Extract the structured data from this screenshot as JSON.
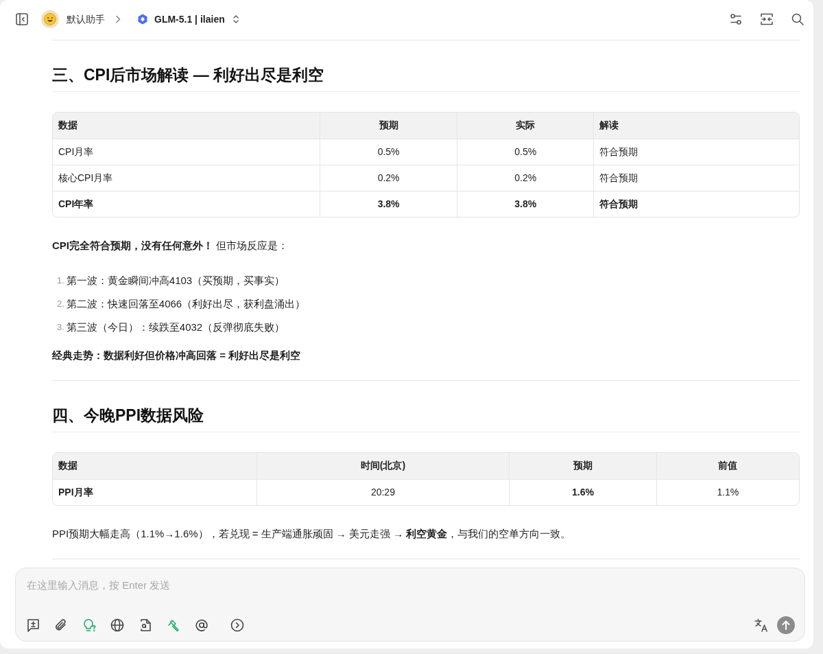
{
  "header": {
    "assistant_name": "默认助手",
    "model": "GLM-5.1 | ilaien"
  },
  "content": [
    {
      "kind": "divider"
    },
    {
      "kind": "heading",
      "text": "三、CPI后市场解读 — 利好出尽是利空"
    },
    {
      "kind": "table",
      "columns": [
        "数据",
        "预期",
        "实际",
        "解读"
      ],
      "rows": [
        {
          "cells": [
            {
              "text": "CPI月率",
              "bold": false
            },
            {
              "text": "0.5%",
              "bold": false
            },
            {
              "text": "0.5%",
              "bold": false
            },
            {
              "text": "符合预期",
              "bold": false
            }
          ]
        },
        {
          "cells": [
            {
              "text": "核心CPI月率",
              "bold": false
            },
            {
              "text": "0.2%",
              "bold": false
            },
            {
              "text": "0.2%",
              "bold": false
            },
            {
              "text": "符合预期",
              "bold": false
            }
          ]
        },
        {
          "cells": [
            {
              "text": "CPI年率",
              "bold": true
            },
            {
              "text": "3.8%",
              "bold": true
            },
            {
              "text": "3.8%",
              "bold": true
            },
            {
              "text": "符合预期",
              "bold": true
            }
          ]
        }
      ]
    },
    {
      "kind": "paragraph",
      "text": "**CPI完全符合预期，没有任何意外！** 但市场反应是：",
      "bold": false
    },
    {
      "kind": "list",
      "items": [
        {
          "number": "1.",
          "text": "第一波：黄金瞬间冲高4103（买预期，买事实）"
        },
        {
          "number": "2.",
          "text": "第二波：快速回落至4066（利好出尽，获利盘涌出）"
        },
        {
          "number": "3.",
          "text": "第三波（今日）：续跌至4032（反弹彻底失败）"
        }
      ]
    },
    {
      "kind": "paragraph",
      "text": "经典走势：数据利好但价格冲高回落 = 利好出尽是利空",
      "bold": true
    },
    {
      "kind": "divider"
    },
    {
      "kind": "heading",
      "text": "四、今晚PPI数据风险"
    },
    {
      "kind": "table",
      "columns": [
        "数据",
        "时间(北京)",
        "预期",
        "前值"
      ],
      "rows": [
        {
          "cells": [
            {
              "text": "PPI月率",
              "bold": true
            },
            {
              "text": "20:29",
              "bold": false
            },
            {
              "text": "1.6%",
              "bold": true
            },
            {
              "text": "1.1%",
              "bold": false
            }
          ]
        }
      ]
    },
    {
      "kind": "paragraph",
      "text": "PPI预期大幅走高（1.1%→1.6%），若兑现 = 生产端通胀顽固 → 美元走强 → **利空黄金**，与我们的空单方向一致。",
      "bold": false
    },
    {
      "kind": "divider"
    }
  ],
  "composer": {
    "placeholder": "在这里输入消息，按 Enter 发送",
    "tools": [
      {
        "kind": "quote",
        "on": false
      },
      {
        "kind": "attach",
        "on": false
      },
      {
        "kind": "thinking",
        "on": true
      },
      {
        "kind": "web",
        "on": false
      },
      {
        "kind": "file",
        "on": false
      },
      {
        "kind": "tools",
        "on": true
      },
      {
        "kind": "mention",
        "on": false
      },
      {
        "kind": "more",
        "on": false
      }
    ]
  }
}
